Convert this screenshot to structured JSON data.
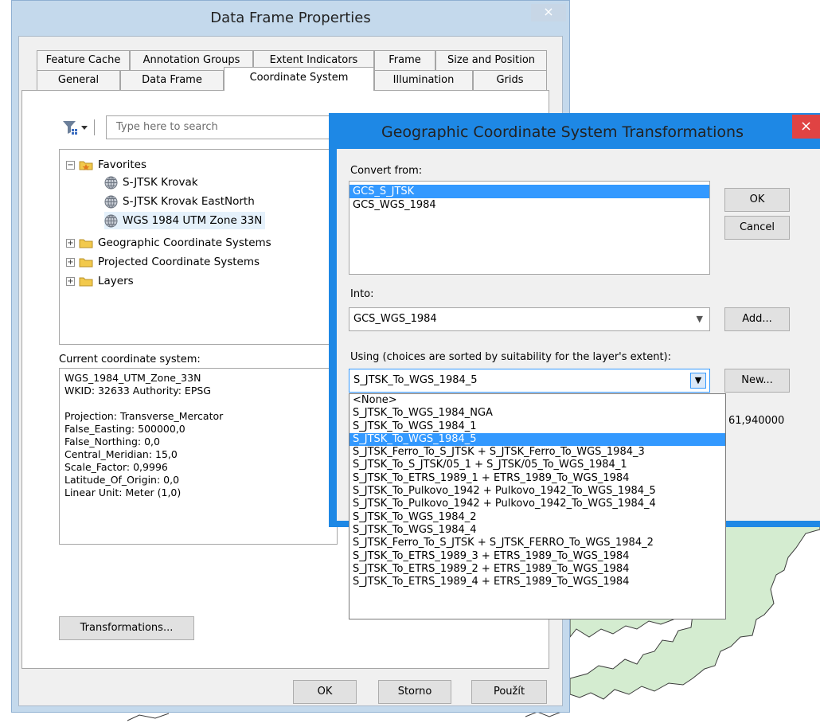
{
  "dialog": {
    "title": "Data Frame Properties",
    "close_glyph": "×",
    "tabs_row1": [
      "Feature Cache",
      "Annotation Groups",
      "Extent Indicators",
      "Frame",
      "Size and Position"
    ],
    "tabs_row2": [
      "General",
      "Data Frame",
      "Coordinate System",
      "Illumination",
      "Grids"
    ],
    "active_tab": "Coordinate System",
    "search_placeholder": "Type here to search",
    "tree": {
      "favorites": "Favorites",
      "favorite_items": [
        "S-JTSK Krovak",
        "S-JTSK Krovak EastNorth",
        "WGS 1984 UTM Zone 33N"
      ],
      "geographic": "Geographic Coordinate Systems",
      "projected": "Projected Coordinate Systems",
      "layers": "Layers"
    },
    "current_label": "Current coordinate system:",
    "current_lines": [
      "WGS_1984_UTM_Zone_33N",
      "WKID: 32633 Authority: EPSG",
      "",
      "Projection: Transverse_Mercator",
      "False_Easting: 500000,0",
      "False_Northing: 0,0",
      "Central_Meridian: 15,0",
      "Scale_Factor: 0,9996",
      "Latitude_Of_Origin: 0,0",
      "Linear Unit: Meter (1,0)"
    ],
    "transformations_button": "Transformations...",
    "ok_button": "OK",
    "cancel_button": "Storno",
    "apply_button": "Použít"
  },
  "gcs_dialog": {
    "title": "Geographic Coordinate System Transformations",
    "close_glyph": "×",
    "convert_from_label": "Convert from:",
    "convert_from_items": [
      "GCS_S_JTSK",
      "GCS_WGS_1984"
    ],
    "convert_from_selected": "GCS_S_JTSK",
    "into_label": "Into:",
    "into_value": "GCS_WGS_1984",
    "using_label": "Using (choices are sorted by suitability for the layer's extent):",
    "using_value": "S_JTSK_To_WGS_1984_5",
    "ok_button": "OK",
    "cancel_button": "Cancel",
    "add_button": "Add...",
    "new_button": "New...",
    "partial_value": "61,940000",
    "dropdown_items": [
      "<None>",
      "S_JTSK_To_WGS_1984_NGA",
      "S_JTSK_To_WGS_1984_1",
      "S_JTSK_To_WGS_1984_5",
      "S_JTSK_Ferro_To_S_JTSK + S_JTSK_Ferro_To_WGS_1984_3",
      "S_JTSK_To_S_JTSK/05_1 + S_JTSK/05_To_WGS_1984_1",
      "S_JTSK_To_ETRS_1989_1 + ETRS_1989_To_WGS_1984",
      "S_JTSK_To_Pulkovo_1942 + Pulkovo_1942_To_WGS_1984_5",
      "S_JTSK_To_Pulkovo_1942 + Pulkovo_1942_To_WGS_1984_4",
      "S_JTSK_To_WGS_1984_2",
      "S_JTSK_To_WGS_1984_4",
      "S_JTSK_Ferro_To_S_JTSK + S_JTSK_FERRO_To_WGS_1984_2",
      "S_JTSK_To_ETRS_1989_3 + ETRS_1989_To_WGS_1984",
      "S_JTSK_To_ETRS_1989_2 + ETRS_1989_To_WGS_1984",
      "S_JTSK_To_ETRS_1989_4 + ETRS_1989_To_WGS_1984"
    ],
    "dropdown_selected": "S_JTSK_To_WGS_1984_5"
  },
  "colors": {
    "map_fill": "#d4ecd0",
    "overlay_frame": "#1e88e5",
    "selection": "#3399ff",
    "close_red": "#e04343"
  }
}
